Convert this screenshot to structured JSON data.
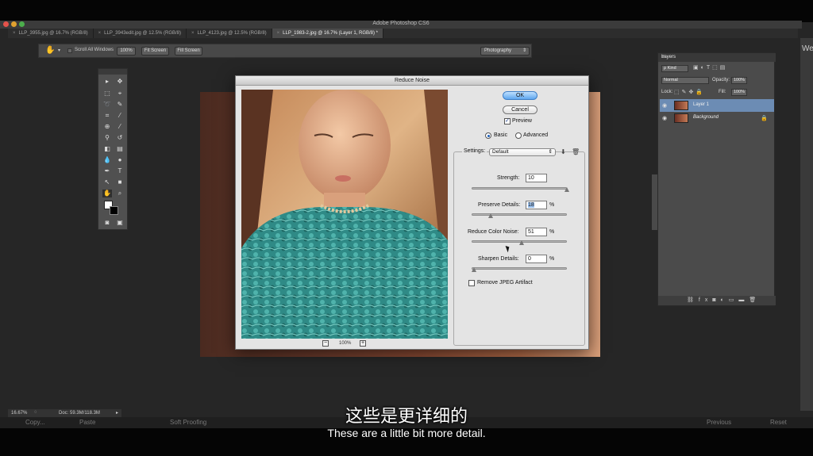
{
  "app": {
    "title": "Adobe Photoshop CS6"
  },
  "tabs": [
    {
      "label": "LLP_3955.jpg @ 16.7% (RGB/8)"
    },
    {
      "label": "LLP_3943edit.jpg @ 12.5% (RGB/8)"
    },
    {
      "label": "LLP_4123.jpg @ 12.5% (RGB/8)"
    },
    {
      "label": "LLP_1983-2.jpg @ 16.7% (Layer 1, RGB/8) *"
    }
  ],
  "options": {
    "scroll_all": "Scroll All Windows",
    "btn_100": "100%",
    "fit_screen": "Fit Screen",
    "fill_screen": "Fill Screen",
    "workspace": "Photography"
  },
  "dialog": {
    "title": "Reduce Noise",
    "ok": "OK",
    "cancel": "Cancel",
    "preview": "Preview",
    "basic": "Basic",
    "advanced": "Advanced",
    "settings_label": "Settings:",
    "settings_value": "Default",
    "strength_label": "Strength:",
    "strength_value": "10",
    "preserve_label": "Preserve Details:",
    "preserve_value": "18",
    "color_noise_label": "Reduce Color Noise:",
    "color_noise_value": "51",
    "sharpen_label": "Sharpen Details:",
    "sharpen_value": "0",
    "percent": "%",
    "jpeg_artifact": "Remove JPEG Artifact",
    "zoom": "100%",
    "zoom_out": "−",
    "zoom_in": "+",
    "slider_fractions": {
      "strength": 1.0,
      "preserve": 0.18,
      "color_noise": 0.51,
      "sharpen": 0.0
    }
  },
  "layers": {
    "tab": "Layers",
    "kind": "ρ Kind",
    "blend": "Normal",
    "opacity_label": "Opacity:",
    "opacity_value": "100%",
    "lock_label": "Lock:",
    "fill_label": "Fill:",
    "fill_value": "100%",
    "items": [
      {
        "name": "Layer 1"
      },
      {
        "name": "Background"
      }
    ]
  },
  "status": {
    "zoom": "16.67%",
    "doc": "Doc: 59.3M/118.3M"
  },
  "lower_bar": {
    "copy": "Copy...",
    "paste": "Paste",
    "soft_proofing": "Soft Proofing",
    "previous": "Previous",
    "reset": "Reset"
  },
  "side_strip": "Web",
  "subtitles": {
    "cn": "这些是更详细的",
    "en": "These are a little bit more detail."
  }
}
